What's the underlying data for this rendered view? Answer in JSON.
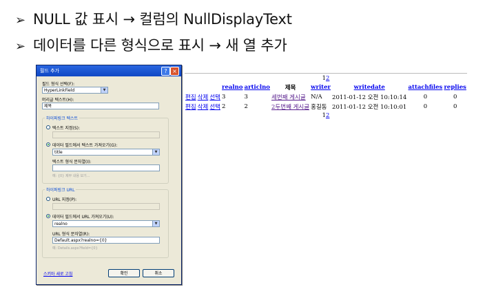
{
  "bullets": [
    {
      "marker": "➢",
      "text": "NULL 값 표시 → 컬럼의 NullDisplayText"
    },
    {
      "marker": "➢",
      "text": "데이터를 다른 형식으로 표시 → 새 열 추가"
    }
  ],
  "dialog": {
    "title": "필드 추가",
    "help_label": "?",
    "close_label": "×",
    "field_type_label": "필드 형식 선택(F):",
    "field_type_value": "HyperLinkField",
    "header_text_label": "머리글 텍스트(H):",
    "header_text_value": "제목",
    "hyperlink_text_group": "하이퍼링크 텍스트",
    "specify_text_label": "텍스트 지정(S):",
    "from_field_text_label": "데이터 필드에서 텍스트 가져오기(G):",
    "text_field_value": "title",
    "text_format_label": "텍스트 형식 문자열(I):",
    "text_format_hint": "예: {0} 제부 내용 보기...",
    "hyperlink_url_group": "하이퍼링크 URL",
    "specify_url_label": "URL 지정(P):",
    "from_field_url_label": "데이터 필드에서 URL 가져오기(U):",
    "url_field_value": "realno",
    "url_format_label": "URL 형식 문자열(R):",
    "url_format_value": "Default.aspx?realno={0}",
    "url_format_hint": "예: Details.aspx?field={0}",
    "refresh_schema_link": "스키마 새로 고침",
    "ok_label": "확인",
    "cancel_label": "취소"
  },
  "grid": {
    "pager": {
      "current": "1",
      "other": "2"
    },
    "headers": [
      "realno",
      "articlno",
      "제목",
      "writer",
      "writedate",
      "attachfiles",
      "replies"
    ],
    "actions": [
      "편집",
      "삭제",
      "선택"
    ],
    "rows": [
      {
        "realno": "3",
        "articlno": "3",
        "title": "세번째 게시글",
        "writer": "N/A",
        "writedate": "2011-01-12 오전 10:10:14",
        "attachfiles": "0",
        "replies": "0"
      },
      {
        "realno": "2",
        "articlno": "2",
        "title": "2두번째 게시글",
        "writer": "홍길동",
        "writedate": "2011-01-12 오전 10:10:01",
        "attachfiles": "0",
        "replies": "0"
      }
    ]
  }
}
